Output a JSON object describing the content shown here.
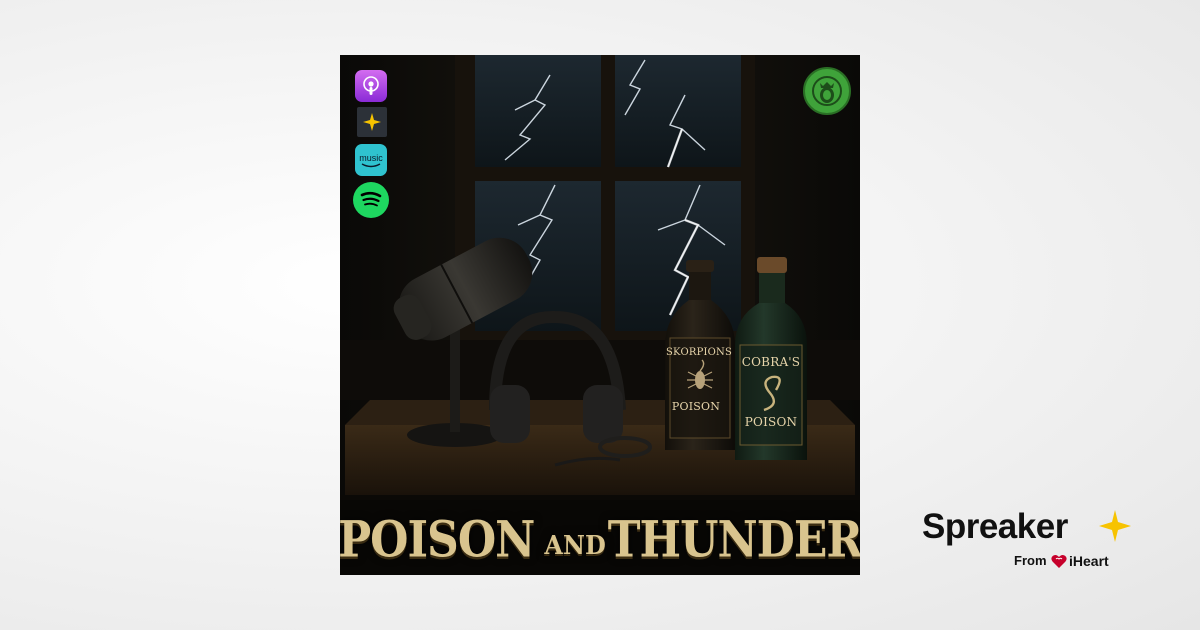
{
  "podcast": {
    "title_part1": "POISON",
    "title_part2": "AND",
    "title_part3": "THUNDER",
    "bottle_left_label_top": "SKORPIONS",
    "bottle_left_label_bottom": "POISON",
    "bottle_right_label_top": "COBRA'S",
    "bottle_right_label_bottom": "POISON",
    "platform_icons": [
      "apple-podcasts-icon",
      "spreaker-icon",
      "amazon-music-icon",
      "spotify-icon"
    ],
    "amazon_music_label": "music",
    "badge_icon": "lion-crest-icon"
  },
  "branding": {
    "spreaker_word": "Spreaker",
    "from_text": "From",
    "iheart_text": "iHeart",
    "star_color": "#f7c300",
    "heart_color": "#c6002b"
  }
}
